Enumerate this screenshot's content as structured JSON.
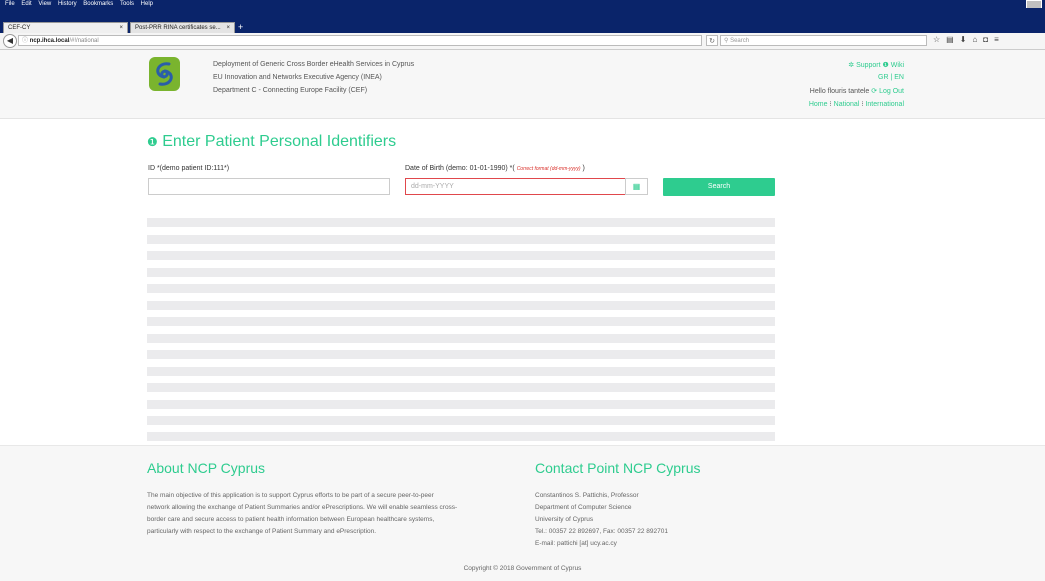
{
  "browser": {
    "menu": [
      "File",
      "Edit",
      "View",
      "History",
      "Bookmarks",
      "Tools",
      "Help"
    ],
    "tabs": [
      {
        "label": "CEF-CY",
        "close": "×"
      },
      {
        "label": "Post-PRR RINA certificates se...",
        "close": "×"
      }
    ],
    "new_tab": "+",
    "url_host": "ncp.ihca.local",
    "url_path": "/#!/national",
    "search_placeholder": "Search",
    "toolbar_icons": [
      "star-icon",
      "bookmarks-icon",
      "download-icon",
      "home-icon",
      "pocket-icon",
      "menu-icon"
    ]
  },
  "header": {
    "lines": [
      "Deployment of Generic Cross Border eHealth Services in Cyprus",
      "EU Innovation and Networks Executive Agency (INEA)",
      "Department C - Connecting Europe Facility (CEF)"
    ],
    "support_label": "Support",
    "wiki_label": "Wiki",
    "lang_gr": "GR",
    "lang_sep": "|",
    "lang_en": "EN",
    "greeting": "Hello flouris tantele",
    "logout_label": "Log Out",
    "nav": {
      "home": "Home",
      "national": "National",
      "international": "International"
    },
    "nav_sep": "⁝"
  },
  "main": {
    "title": "Enter Patient Personal Identifiers",
    "id_label": "ID *(demo patient ID:111*)",
    "id_value": "",
    "dob_label": "Date of Birth (demo: 01-01-1990) *(",
    "dob_hint": "Correct format (dd-mm-yyyy)",
    "dob_label_end": ")",
    "dob_placeholder": "dd-mm-YYYY",
    "search_button": "Search",
    "result_rows": 14
  },
  "footer": {
    "about_title": "About NCP Cyprus",
    "about_lines": [
      "The main objective of this application is to support Cyprus efforts to be part of a secure peer-to-peer",
      "network allowing the exchange of Patient Summaries and/or ePrescriptions. We will enable seamless cross-",
      "border care and secure access to patient health information between European healthcare systems,",
      "particularly with respect to the exchange of Patient Summary and ePrescription."
    ],
    "contact_title": "Contact Point NCP Cyprus",
    "contact_lines": [
      "Constantinos S. Pattichis, Professor",
      "Department of Computer Science",
      "University of Cyprus",
      "Tel.: 00357 22 892697, Fax: 00357 22 892701",
      "E-mail: pattichi [at] ucy.ac.cy"
    ],
    "copyright": "Copyright © 2018 Government of Cyprus"
  },
  "colors": {
    "accent": "#2ecc8f",
    "error": "#d9302a",
    "logo": "#7ab42e"
  }
}
